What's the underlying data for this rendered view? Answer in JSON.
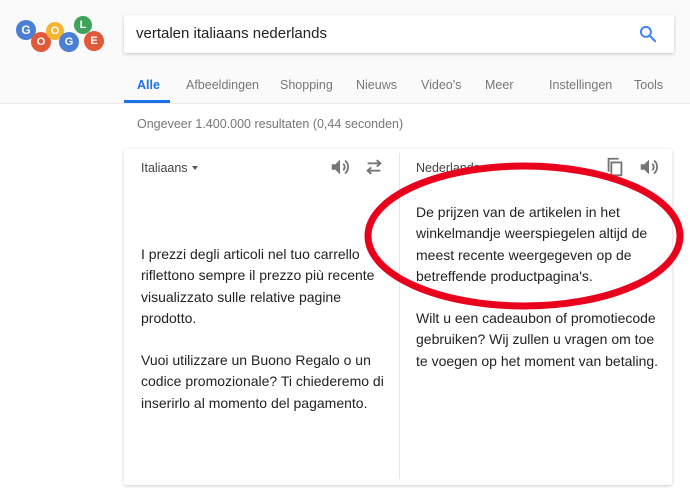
{
  "search": {
    "query": "vertalen italiaans nederlands"
  },
  "logo": {
    "letters": [
      "G",
      "O",
      "O",
      "G",
      "L",
      "E"
    ],
    "colors": [
      "#4a7fd3",
      "#e05a3a",
      "#f2b632",
      "#4a7fd3",
      "#3fa35b",
      "#e05a3a"
    ]
  },
  "tabs": [
    {
      "label": "Alle",
      "active": true
    },
    {
      "label": "Afbeeldingen",
      "active": false
    },
    {
      "label": "Shopping",
      "active": false
    },
    {
      "label": "Nieuws",
      "active": false
    },
    {
      "label": "Video's",
      "active": false
    },
    {
      "label": "Meer",
      "active": false
    },
    {
      "label": "Instellingen",
      "active": false
    },
    {
      "label": "Tools",
      "active": false
    }
  ],
  "results": {
    "count_text": "Ongeveer 1.400.000 resultaten (0,44 seconden)"
  },
  "translator": {
    "source_language": "Italiaans",
    "target_language": "Nederlands",
    "source_paragraphs": [
      "I prezzi degli articoli nel tuo carrello riflettono sempre il prezzo più recente visualizzato sulle relative pagine prodotto.",
      "Vuoi utilizzare un Buono Regalo o un codice promozionale? Ti chiederemo di inserirlo al momento del pagamento."
    ],
    "target_paragraphs": [
      "De prijzen van de artikelen in het winkelmandje weerspiegelen altijd de meest recente weergegeven op de betreffende productpagina's.",
      "Wilt u een cadeaubon of promotiecode gebruiken? Wij zullen u vragen om toe te voegen op het moment van betaling."
    ]
  },
  "colors": {
    "accent": "#1a73e8",
    "annotation": "#e8001c"
  }
}
